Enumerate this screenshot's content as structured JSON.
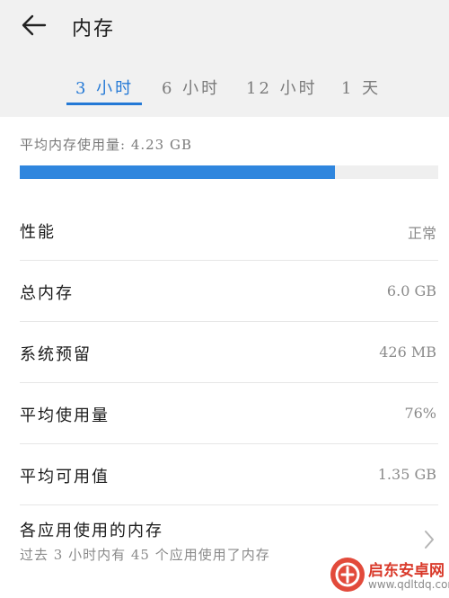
{
  "header": {
    "title": "内存"
  },
  "tabs": [
    {
      "label": "3 小时",
      "active": true
    },
    {
      "label": "6 小时",
      "active": false
    },
    {
      "label": "12 小时",
      "active": false
    },
    {
      "label": "1 天",
      "active": false
    }
  ],
  "usage": {
    "avg_label": "平均内存使用量: 4.23 GB",
    "bar_fill_percent": 75.4,
    "bar_color": "#2f86de"
  },
  "rows": [
    {
      "label": "性能",
      "value": "正常"
    },
    {
      "label": "总内存",
      "value": "6.0 GB"
    },
    {
      "label": "系统预留",
      "value": "426 MB"
    },
    {
      "label": "平均使用量",
      "value": "76%"
    },
    {
      "label": "平均可用值",
      "value": "1.35 GB"
    }
  ],
  "apps": {
    "title": "各应用使用的内存",
    "subtitle": "过去 3 小时内有 45 个应用使用了内存"
  },
  "watermark": {
    "text": "启东安卓网",
    "url": "www.qdltdq.com"
  },
  "colors": {
    "accent": "#2479d6",
    "header_bg": "#f1f1f1"
  }
}
